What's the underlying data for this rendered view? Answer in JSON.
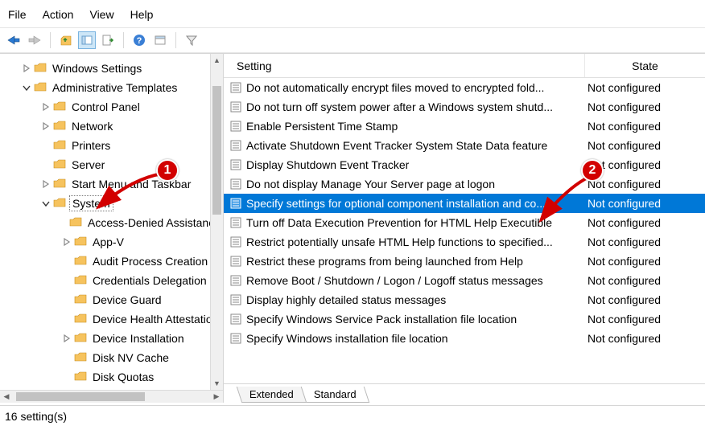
{
  "menu": {
    "file": "File",
    "action": "Action",
    "view": "View",
    "help": "Help"
  },
  "header": {
    "col_setting": "Setting",
    "col_state": "State"
  },
  "tree": {
    "windows_settings": "Windows Settings",
    "admin_templates": "Administrative Templates",
    "control_panel": "Control Panel",
    "network": "Network",
    "printers": "Printers",
    "server": "Server",
    "start_menu": "Start Menu and Taskbar",
    "system": "System",
    "access_denied": "Access-Denied Assistance",
    "appv": "App-V",
    "audit": "Audit Process Creation",
    "credentials": "Credentials Delegation",
    "device_guard": "Device Guard",
    "device_health": "Device Health Attestation",
    "device_install": "Device Installation",
    "disk_nv": "Disk NV Cache",
    "disk_quotas": "Disk Quotas"
  },
  "rows": [
    {
      "text": "Do not automatically encrypt files moved to encrypted fold...",
      "state": "Not configured"
    },
    {
      "text": "Do not turn off system power after a Windows system shutd...",
      "state": "Not configured"
    },
    {
      "text": "Enable Persistent Time Stamp",
      "state": "Not configured"
    },
    {
      "text": "Activate Shutdown Event Tracker System State Data feature",
      "state": "Not configured"
    },
    {
      "text": "Display Shutdown Event Tracker",
      "state": "Not configured"
    },
    {
      "text": "Do not display Manage Your Server page at logon",
      "state": "Not configured"
    },
    {
      "text": "Specify settings for optional component installation and co...",
      "state": "Not configured"
    },
    {
      "text": "Turn off Data Execution Prevention for HTML Help Executible",
      "state": "Not configured"
    },
    {
      "text": "Restrict potentially unsafe HTML Help functions to specified...",
      "state": "Not configured"
    },
    {
      "text": "Restrict these programs from being launched from Help",
      "state": "Not configured"
    },
    {
      "text": "Remove Boot / Shutdown / Logon / Logoff status messages",
      "state": "Not configured"
    },
    {
      "text": "Display highly detailed status messages",
      "state": "Not configured"
    },
    {
      "text": "Specify Windows Service Pack installation file location",
      "state": "Not configured"
    },
    {
      "text": "Specify Windows installation file location",
      "state": "Not configured"
    }
  ],
  "selected_row_index": 6,
  "tabs": {
    "extended": "Extended",
    "standard": "Standard"
  },
  "status": "16 setting(s)",
  "annotations": {
    "badge1": "1",
    "badge2": "2"
  }
}
